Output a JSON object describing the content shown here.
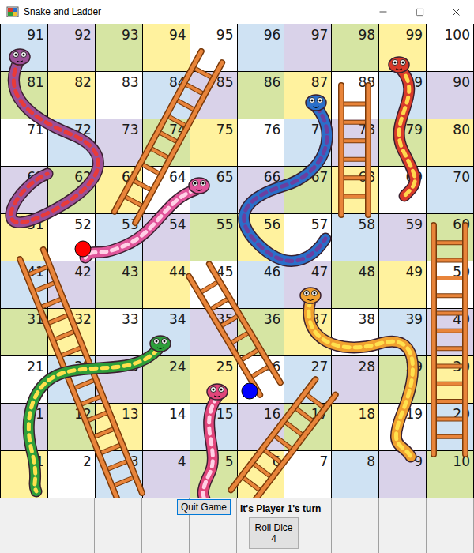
{
  "window": {
    "title": "Snake and Ladder"
  },
  "board": {
    "rows": [
      [
        {
          "number": "91",
          "color": "#cfe2f3"
        },
        {
          "number": "92",
          "color": "#d9d2e9"
        },
        {
          "number": "93",
          "color": "#d6e5a3"
        },
        {
          "number": "94",
          "color": "#fff29e"
        },
        {
          "number": "95",
          "color": "#ffffff"
        },
        {
          "number": "96",
          "color": "#cfe2f3"
        },
        {
          "number": "97",
          "color": "#d9d2e9"
        },
        {
          "number": "98",
          "color": "#d6e5a3"
        },
        {
          "number": "99",
          "color": "#fff29e"
        },
        {
          "number": "100",
          "color": "#ffffff"
        }
      ],
      [
        {
          "number": "81",
          "color": "#d6e5a3"
        },
        {
          "number": "82",
          "color": "#fff29e"
        },
        {
          "number": "83",
          "color": "#ffffff"
        },
        {
          "number": "84",
          "color": "#cfe2f3"
        },
        {
          "number": "85",
          "color": "#d9d2e9"
        },
        {
          "number": "86",
          "color": "#d6e5a3"
        },
        {
          "number": "87",
          "color": "#fff29e"
        },
        {
          "number": "88",
          "color": "#ffffff"
        },
        {
          "number": "89",
          "color": "#cfe2f3"
        },
        {
          "number": "90",
          "color": "#d9d2e9"
        }
      ],
      [
        {
          "number": "71",
          "color": "#ffffff"
        },
        {
          "number": "72",
          "color": "#cfe2f3"
        },
        {
          "number": "73",
          "color": "#d9d2e9"
        },
        {
          "number": "74",
          "color": "#d6e5a3"
        },
        {
          "number": "75",
          "color": "#fff29e"
        },
        {
          "number": "76",
          "color": "#ffffff"
        },
        {
          "number": "77",
          "color": "#cfe2f3"
        },
        {
          "number": "78",
          "color": "#d9d2e9"
        },
        {
          "number": "79",
          "color": "#d6e5a3"
        },
        {
          "number": "80",
          "color": "#fff29e"
        }
      ],
      [
        {
          "number": "61",
          "color": "#d9d2e9"
        },
        {
          "number": "62",
          "color": "#d6e5a3"
        },
        {
          "number": "63",
          "color": "#fff29e"
        },
        {
          "number": "64",
          "color": "#ffffff"
        },
        {
          "number": "65",
          "color": "#cfe2f3"
        },
        {
          "number": "66",
          "color": "#d9d2e9"
        },
        {
          "number": "67",
          "color": "#d6e5a3"
        },
        {
          "number": "68",
          "color": "#fff29e"
        },
        {
          "number": "69",
          "color": "#ffffff"
        },
        {
          "number": "70",
          "color": "#cfe2f3"
        }
      ],
      [
        {
          "number": "51",
          "color": "#fff29e"
        },
        {
          "number": "52",
          "color": "#ffffff"
        },
        {
          "number": "53",
          "color": "#cfe2f3"
        },
        {
          "number": "54",
          "color": "#d9d2e9"
        },
        {
          "number": "55",
          "color": "#d6e5a3"
        },
        {
          "number": "56",
          "color": "#fff29e"
        },
        {
          "number": "57",
          "color": "#ffffff"
        },
        {
          "number": "58",
          "color": "#cfe2f3"
        },
        {
          "number": "59",
          "color": "#d9d2e9"
        },
        {
          "number": "60",
          "color": "#d6e5a3"
        }
      ],
      [
        {
          "number": "41",
          "color": "#cfe2f3"
        },
        {
          "number": "42",
          "color": "#d9d2e9"
        },
        {
          "number": "43",
          "color": "#d6e5a3"
        },
        {
          "number": "44",
          "color": "#fff29e"
        },
        {
          "number": "45",
          "color": "#ffffff"
        },
        {
          "number": "46",
          "color": "#cfe2f3"
        },
        {
          "number": "47",
          "color": "#d9d2e9"
        },
        {
          "number": "48",
          "color": "#d6e5a3"
        },
        {
          "number": "49",
          "color": "#fff29e"
        },
        {
          "number": "50",
          "color": "#ffffff"
        }
      ],
      [
        {
          "number": "31",
          "color": "#d6e5a3"
        },
        {
          "number": "32",
          "color": "#fff29e"
        },
        {
          "number": "33",
          "color": "#ffffff"
        },
        {
          "number": "34",
          "color": "#cfe2f3"
        },
        {
          "number": "35",
          "color": "#d9d2e9"
        },
        {
          "number": "36",
          "color": "#d6e5a3"
        },
        {
          "number": "37",
          "color": "#fff29e"
        },
        {
          "number": "38",
          "color": "#ffffff"
        },
        {
          "number": "39",
          "color": "#cfe2f3"
        },
        {
          "number": "40",
          "color": "#d9d2e9"
        }
      ],
      [
        {
          "number": "21",
          "color": "#ffffff"
        },
        {
          "number": "22",
          "color": "#cfe2f3"
        },
        {
          "number": "23",
          "color": "#d9d2e9"
        },
        {
          "number": "24",
          "color": "#d6e5a3"
        },
        {
          "number": "25",
          "color": "#fff29e"
        },
        {
          "number": "26",
          "color": "#ffffff"
        },
        {
          "number": "27",
          "color": "#cfe2f3"
        },
        {
          "number": "28",
          "color": "#d9d2e9"
        },
        {
          "number": "29",
          "color": "#d6e5a3"
        },
        {
          "number": "30",
          "color": "#fff29e"
        }
      ],
      [
        {
          "number": "11",
          "color": "#d9d2e9"
        },
        {
          "number": "12",
          "color": "#d6e5a3"
        },
        {
          "number": "13",
          "color": "#fff29e"
        },
        {
          "number": "14",
          "color": "#ffffff"
        },
        {
          "number": "15",
          "color": "#cfe2f3"
        },
        {
          "number": "16",
          "color": "#d9d2e9"
        },
        {
          "number": "17",
          "color": "#d6e5a3"
        },
        {
          "number": "18",
          "color": "#fff29e"
        },
        {
          "number": "19",
          "color": "#ffffff"
        },
        {
          "number": "20",
          "color": "#cfe2f3"
        }
      ],
      [
        {
          "number": "1",
          "color": "#fff29e"
        },
        {
          "number": "2",
          "color": "#ffffff"
        },
        {
          "number": "3",
          "color": "#cfe2f3"
        },
        {
          "number": "4",
          "color": "#d9d2e9"
        },
        {
          "number": "5",
          "color": "#d6e5a3"
        },
        {
          "number": "6",
          "color": "#fff29e"
        },
        {
          "number": "7",
          "color": "#ffffff"
        },
        {
          "number": "8",
          "color": "#cfe2f3"
        },
        {
          "number": "9",
          "color": "#d9d2e9"
        },
        {
          "number": "10",
          "color": "#d6e5a3"
        }
      ]
    ]
  },
  "players": [
    {
      "color": "#ff0000",
      "cell": 52
    },
    {
      "color": "#0000ff",
      "cell": 26
    }
  ],
  "controls": {
    "quit": "Quit Game",
    "turn": "It's Player 1's turn",
    "roll": {
      "label": "Roll Dice",
      "value": "4"
    }
  }
}
